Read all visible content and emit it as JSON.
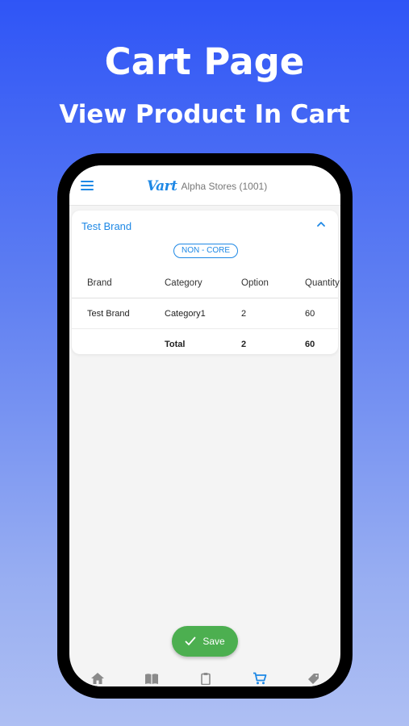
{
  "promo": {
    "title": "Cart Page",
    "subtitle": "View Product In Cart"
  },
  "header": {
    "logo": "Vart",
    "store_name": "Alpha Stores (1001)"
  },
  "card": {
    "title": "Test Brand",
    "badge": "NON - CORE",
    "columns": [
      "Brand",
      "Category",
      "Option",
      "Quantity"
    ],
    "rows": [
      [
        "Test Brand",
        "Category1",
        "2",
        "60"
      ]
    ],
    "total": [
      "",
      "Total",
      "2",
      "60"
    ]
  },
  "save_button": {
    "label": "Save"
  },
  "colors": {
    "accent": "#1e88e5",
    "save": "#4caf50"
  },
  "bottom_nav": [
    "home-icon",
    "book-icon",
    "clipboard-icon",
    "cart-icon",
    "tag-icon"
  ]
}
